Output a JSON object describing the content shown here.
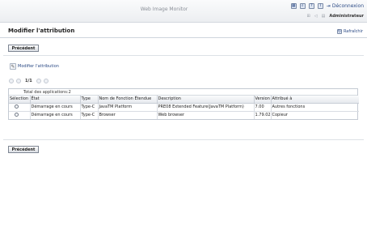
{
  "header": {
    "app_title": "Web Image Monitor",
    "logout_label": "Déconnexion",
    "user_name": "Administrateur"
  },
  "page": {
    "title": "Modifier l'attribution",
    "refresh_label": "Rafraîchir"
  },
  "buttons": {
    "back_top": "Précédent",
    "back_bottom": "Précédent"
  },
  "modify_link": "Modifier l'attribution",
  "pager": {
    "page_text": "1/1"
  },
  "table": {
    "total_label": "Total des applications:2",
    "columns": [
      "Sélection",
      "État",
      "Type",
      "Nom de Fonction Étendue",
      "Description",
      "Version",
      "Attribué à"
    ],
    "rows": [
      [
        "",
        "Démarrage en cours",
        "Type-C",
        "JavaTM Platform",
        "PRE08 Extended Feature(JavaTM Platform)",
        "7.00",
        "Autres fonctions"
      ],
      [
        "",
        "Démarrage en cours",
        "Type-C",
        "Browser",
        "Web browser",
        "1.79.02",
        "Copieur"
      ]
    ]
  }
}
